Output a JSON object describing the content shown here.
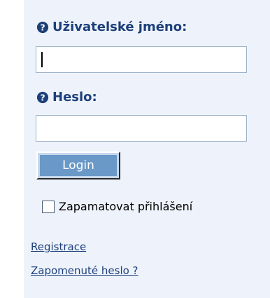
{
  "login_form": {
    "username_label": "Uživatelské jméno:",
    "password_label": "Heslo:",
    "username_value": "",
    "password_value": "",
    "login_button_label": "Login",
    "remember_label": "Zapamatovat přihlášení",
    "remember_checked": false,
    "register_link": "Registrace",
    "forgot_password_link": "Zapomenuté heslo ?",
    "help_icon": "help-question-icon"
  },
  "colors": {
    "panel_background": "#eef3fb",
    "label_text": "#1d3f7a",
    "button_face": "#6a99c8",
    "link_text": "#1d3f7a"
  }
}
